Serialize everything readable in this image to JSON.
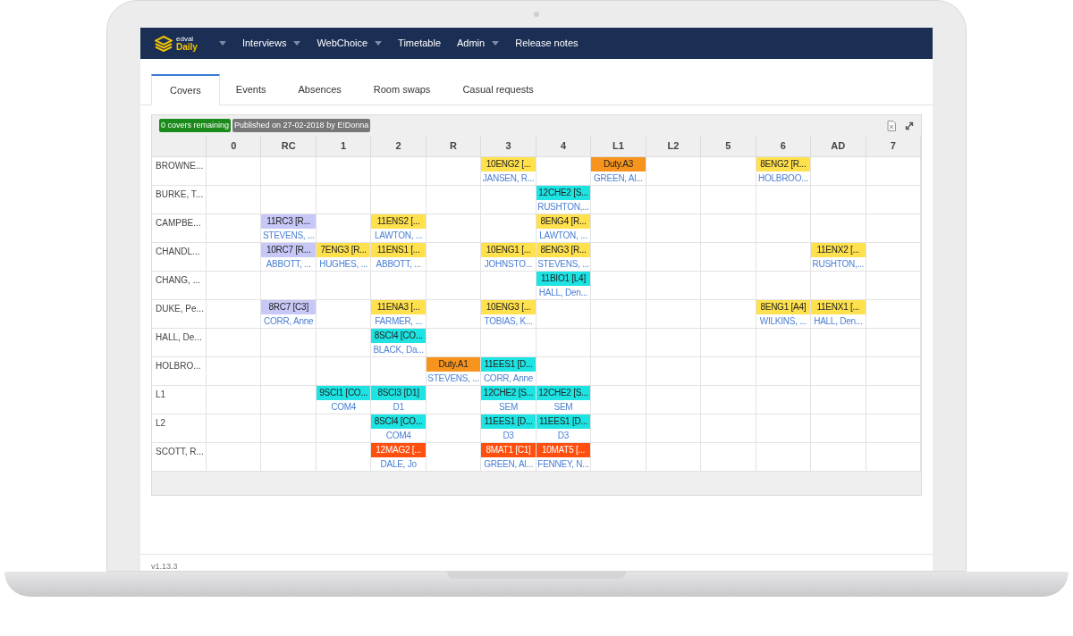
{
  "nav": {
    "logo_small": "edval",
    "logo": "Daily",
    "logo_has_menu": true,
    "items": [
      {
        "label": "Interviews",
        "has_menu": true
      },
      {
        "label": "WebChoice",
        "has_menu": true
      },
      {
        "label": "Timetable",
        "has_menu": false
      },
      {
        "label": "Admin",
        "has_menu": true
      },
      {
        "label": "Release notes",
        "has_menu": false
      }
    ]
  },
  "tabs": [
    {
      "label": "Covers",
      "selected": true
    },
    {
      "label": "Events",
      "selected": false
    },
    {
      "label": "Absences",
      "selected": false
    },
    {
      "label": "Room swaps",
      "selected": false
    },
    {
      "label": "Casual requests",
      "selected": false
    }
  ],
  "badges": [
    {
      "text": "0 covers remaining",
      "color": "#1a8a1a"
    },
    {
      "text": "Published on 27-02-2018 by E!Donna",
      "color": "#777777"
    }
  ],
  "table": {
    "columns": [
      "0",
      "RC",
      "1",
      "2",
      "R",
      "3",
      "4",
      "L1",
      "L2",
      "5",
      "6",
      "AD",
      "7"
    ],
    "rows": [
      {
        "name": "BROWNE...",
        "cells": [
          null,
          null,
          null,
          null,
          null,
          {
            "label": "10ENG2 [...",
            "sub": "JANSEN, R...",
            "color": "#ffe14d"
          },
          null,
          {
            "label": "Duty.A3",
            "sub": "GREEN, Al...",
            "color": "#f7941d"
          },
          null,
          null,
          {
            "label": "8ENG2 [R...",
            "sub": "HOLBROO...",
            "color": "#ffe14d"
          },
          null,
          null
        ]
      },
      {
        "name": "BURKE, T...",
        "cells": [
          null,
          null,
          null,
          null,
          null,
          null,
          {
            "label": "12CHE2 [S...",
            "sub": "RUSHTON,...",
            "color": "#1ee3e3"
          },
          null,
          null,
          null,
          null,
          null,
          null
        ]
      },
      {
        "name": "CAMPBE...",
        "cells": [
          null,
          {
            "label": "11RC3 [R...",
            "sub": "STEVENS, ...",
            "color": "#c8c8f8"
          },
          null,
          {
            "label": "11ENS2 [...",
            "sub": "LAWTON, ...",
            "color": "#ffe14d"
          },
          null,
          null,
          {
            "label": "8ENG4 [R...",
            "sub": "LAWTON, ...",
            "color": "#ffe14d"
          },
          null,
          null,
          null,
          null,
          null,
          null
        ]
      },
      {
        "name": "CHANDL...",
        "cells": [
          null,
          {
            "label": "10RC7 [R...",
            "sub": "ABBOTT, ...",
            "color": "#c8c8f8"
          },
          {
            "label": "7ENG3 [R...",
            "sub": "HUGHES, ...",
            "color": "#ffe14d"
          },
          {
            "label": "11ENS1 [...",
            "sub": "ABBOTT, ...",
            "color": "#ffe14d"
          },
          null,
          {
            "label": "10ENG1 [...",
            "sub": "JOHNSTO...",
            "color": "#ffe14d"
          },
          {
            "label": "8ENG3 [R...",
            "sub": "STEVENS, ...",
            "color": "#ffe14d"
          },
          null,
          null,
          null,
          null,
          {
            "label": "11ENX2 [...",
            "sub": "RUSHTON,...",
            "color": "#ffe14d"
          },
          null
        ]
      },
      {
        "name": "CHANG, ...",
        "cells": [
          null,
          null,
          null,
          null,
          null,
          null,
          {
            "label": "11BIO1 [L4]",
            "sub": "HALL, Den...",
            "color": "#1ee3e3"
          },
          null,
          null,
          null,
          null,
          null,
          null
        ]
      },
      {
        "name": "DUKE, Pe...",
        "cells": [
          null,
          {
            "label": "8RC7 [C3]",
            "sub": "CORR, Anne",
            "color": "#c8c8f8"
          },
          null,
          {
            "label": "11ENA3 [...",
            "sub": "FARMER, ...",
            "color": "#ffe14d"
          },
          null,
          {
            "label": "10ENG3 [...",
            "sub": "TOBIAS, K...",
            "color": "#ffe14d"
          },
          null,
          null,
          null,
          null,
          {
            "label": "8ENG1 [A4]",
            "sub": "WILKINS, ...",
            "color": "#ffe14d"
          },
          {
            "label": "11ENX1 [...",
            "sub": "HALL, Den...",
            "color": "#ffe14d"
          },
          null
        ]
      },
      {
        "name": "HALL, De...",
        "cells": [
          null,
          null,
          null,
          {
            "label": "8SCI4 [CO...",
            "sub": "BLACK, Da...",
            "color": "#1ee3e3"
          },
          null,
          null,
          null,
          null,
          null,
          null,
          null,
          null,
          null
        ]
      },
      {
        "name": "HOLBRO...",
        "cells": [
          null,
          null,
          null,
          null,
          {
            "label": "Duty.A1",
            "sub": "STEVENS, ...",
            "color": "#f7941d"
          },
          {
            "label": "11EES1 [D...",
            "sub": "CORR, Anne",
            "color": "#1ee3e3"
          },
          null,
          null,
          null,
          null,
          null,
          null,
          null
        ]
      },
      {
        "name": "L1",
        "cells": [
          null,
          null,
          {
            "label": "9SCI1 [CO...",
            "sub": "COM4",
            "color": "#1ee3e3"
          },
          {
            "label": "8SCI3 [D1]",
            "sub": "D1",
            "color": "#1ee3e3"
          },
          null,
          {
            "label": "12CHE2 [S...",
            "sub": "SEM",
            "color": "#1ee3e3"
          },
          {
            "label": "12CHE2 [S...",
            "sub": "SEM",
            "color": "#1ee3e3"
          },
          null,
          null,
          null,
          null,
          null,
          null
        ]
      },
      {
        "name": "L2",
        "cells": [
          null,
          null,
          null,
          {
            "label": "8SCI4 [CO...",
            "sub": "COM4",
            "color": "#1ee3e3"
          },
          null,
          {
            "label": "11EES1 [D...",
            "sub": "D3",
            "color": "#1ee3e3"
          },
          {
            "label": "11EES1 [D...",
            "sub": "D3",
            "color": "#1ee3e3"
          },
          null,
          null,
          null,
          null,
          null,
          null
        ]
      },
      {
        "name": "SCOTT, R...",
        "cells": [
          null,
          null,
          null,
          {
            "label": "12MAG2 [...",
            "sub": "DALE, Jo",
            "color": "#ff4f0f"
          },
          null,
          {
            "label": "8MAT1 [C1]",
            "sub": "GREEN, Al...",
            "color": "#ff4f0f"
          },
          {
            "label": "10MAT5 [...",
            "sub": "FENNEY, N...",
            "color": "#ff4f0f"
          },
          null,
          null,
          null,
          null,
          null,
          null
        ]
      }
    ]
  },
  "version": "v1.13.3"
}
